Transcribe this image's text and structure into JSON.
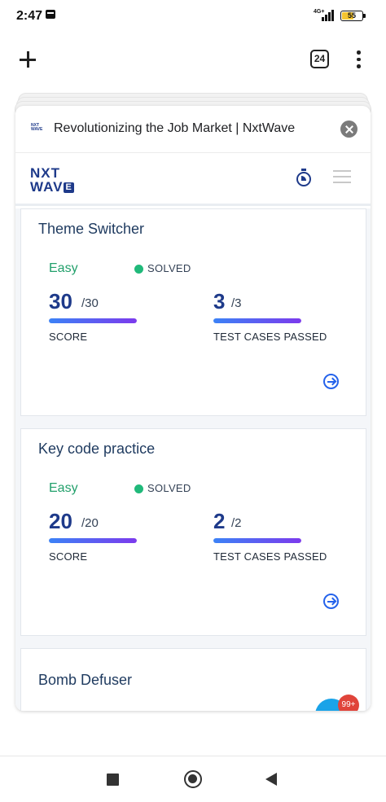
{
  "status_bar": {
    "time": "2:47",
    "network": "4G+",
    "battery": "55",
    "battery_level": 0.55
  },
  "browser": {
    "tab_count": "24",
    "new_tab_icon": "plus-icon",
    "menu_icon": "more-vert-icon"
  },
  "page": {
    "title": "Revolutionizing the Job Market | NxtWave",
    "favicon_text": "NXT WAVE"
  },
  "site": {
    "logo_line1": "NXT",
    "logo_line2": "WAV",
    "logo_box": "E"
  },
  "cards": [
    {
      "title": "Theme Switcher",
      "difficulty": "Easy",
      "status": "SOLVED",
      "score": "30",
      "score_total": "/30",
      "score_label": "SCORE",
      "score_fraction": 1.0,
      "tests": "3",
      "tests_total": "/3",
      "tests_label": "TEST CASES PASSED",
      "tests_fraction": 1.0
    },
    {
      "title": "Key code practice",
      "difficulty": "Easy",
      "status": "SOLVED",
      "score": "20",
      "score_total": "/20",
      "score_label": "SCORE",
      "score_fraction": 1.0,
      "tests": "2",
      "tests_total": "/2",
      "tests_label": "TEST CASES PASSED",
      "tests_fraction": 1.0
    },
    {
      "title": "Bomb Defuser"
    }
  ],
  "notification_badge": "99+",
  "colors": {
    "brand": "#1e3a8a",
    "easy": "#22a06b",
    "solved": "#20b97a",
    "accent": "#2563eb",
    "badge": "#e0443a"
  }
}
